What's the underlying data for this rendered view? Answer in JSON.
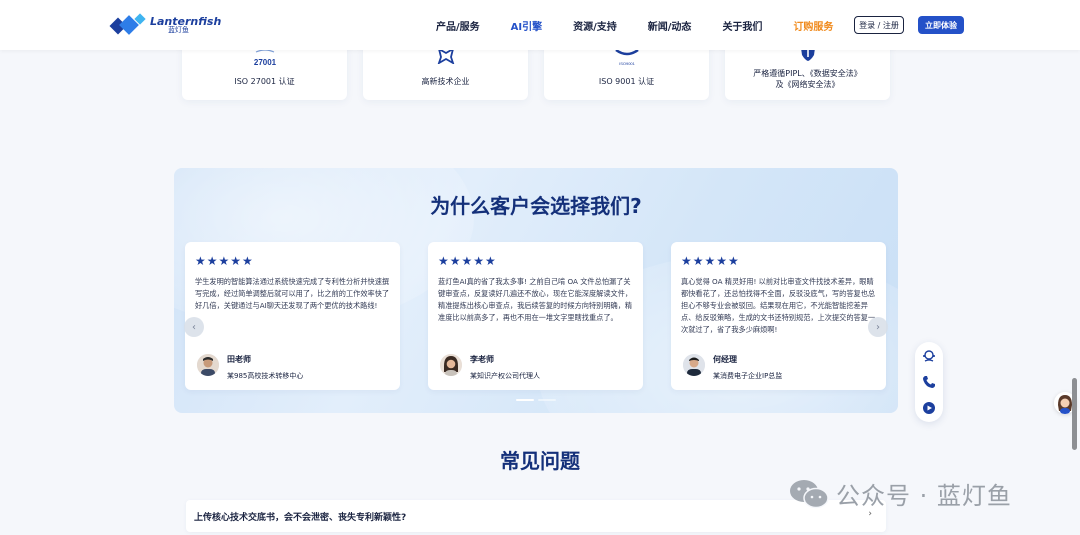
{
  "header": {
    "logo_en": "Lanternfish",
    "logo_cn": "蓝灯鱼",
    "nav": [
      {
        "label": "产品/服务",
        "state": "normal"
      },
      {
        "label": "AI引擎",
        "state": "active"
      },
      {
        "label": "资源/支持",
        "state": "normal"
      },
      {
        "label": "新闻/动态",
        "state": "normal"
      },
      {
        "label": "关于我们",
        "state": "normal"
      },
      {
        "label": "订购服务",
        "state": "highlight"
      }
    ],
    "login_label": "登录 / 注册",
    "try_label": "立即体验"
  },
  "certs": [
    {
      "icon": "iso-27001-badge-icon",
      "badge_text": "27001",
      "label": "ISO 27001 认证"
    },
    {
      "icon": "high-tech-enterprise-icon",
      "label": "高新技术企业"
    },
    {
      "icon": "iso-9001-badge-icon",
      "badge_text": "ISO9001",
      "label": "ISO 9001 认证"
    },
    {
      "icon": "shield-icon",
      "label_line1": "严格遵循PIPL、《数据安全法》",
      "label_line2": "及《网络安全法》"
    }
  ],
  "why": {
    "title": "为什么客户会选择我们?",
    "reviews": [
      {
        "stars": "★★★★★",
        "text": "学生发明的智能算法通过系统快速完成了专利性分析并快速撰写完成，经过简单调整后就可以用了，比之前的工作效率快了好几倍，关键通过与AI聊天还发现了两个更优的技术路线!",
        "name": "田老师",
        "org": "某985高校技术转移中心"
      },
      {
        "stars": "★★★★★",
        "text": "蓝灯鱼AI真的省了我太多事! 之前自己啃 OA 文件总怕漏了关键审查点，反复读好几遍还不放心，现在它能深度解读文件，精准提炼出核心审查点，我后续答复的时候方向特别明确，精准度比以前高多了，再也不用在一堆文字里瞎找重点了。",
        "name": "李老师",
        "org": "某知识产权公司代理人"
      },
      {
        "stars": "★★★★★",
        "text": "真心觉得 OA 精灵好用! 以前对比审查文件找技术差异，眼睛都快看花了，还总怕找得不全面，反驳没底气，写的答复也总担心不够专业会被驳回。结果现在用它，不光能智能挖差异点、给反驳策略，生成的文书还特别规范，上次提交的答复一次就过了，省了我多少麻烦啊!",
        "name": "何经理",
        "org": "某消费电子企业IP总监"
      }
    ],
    "carousel": {
      "active_index": 0,
      "count": 2
    }
  },
  "faq": {
    "title": "常见问题",
    "items": [
      {
        "question": "上传核心技术交底书，会不会泄密、丧失专利新颖性?"
      }
    ]
  },
  "watermark": {
    "text": "公众号 · 蓝灯鱼"
  },
  "colors": {
    "brand_blue": "#2451c8",
    "title_navy": "#14307a",
    "order_orange": "#f08a1c",
    "star_blue": "#1c3f9e"
  }
}
